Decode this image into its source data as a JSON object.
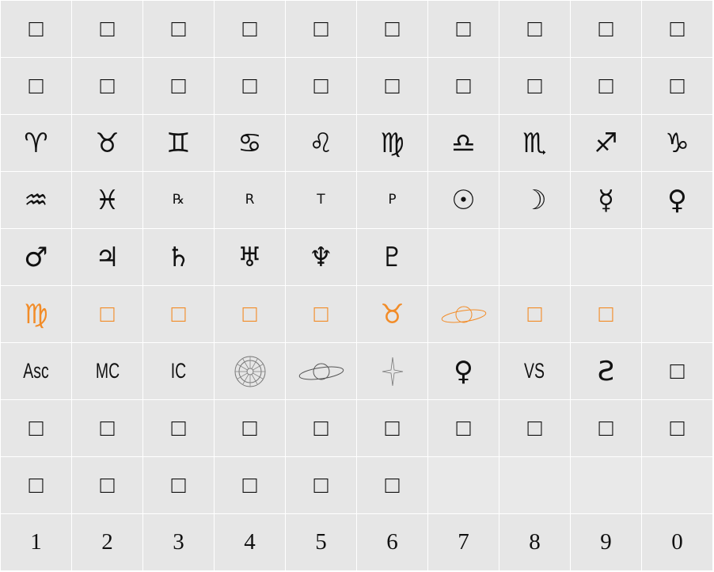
{
  "colors": {
    "background": "#e6e6e6",
    "ink": "#111111",
    "accent": "#f28c28",
    "divider": "#ffffff"
  },
  "rows": [
    [
      {
        "glyph": "□",
        "kind": "notdef"
      },
      {
        "glyph": "□",
        "kind": "notdef"
      },
      {
        "glyph": "□",
        "kind": "notdef"
      },
      {
        "glyph": "□",
        "kind": "notdef"
      },
      {
        "glyph": "□",
        "kind": "notdef"
      },
      {
        "glyph": "□",
        "kind": "notdef"
      },
      {
        "glyph": "□",
        "kind": "notdef"
      },
      {
        "glyph": "□",
        "kind": "notdef"
      },
      {
        "glyph": "□",
        "kind": "notdef"
      },
      {
        "glyph": "□",
        "kind": "notdef"
      }
    ],
    [
      {
        "glyph": "□",
        "kind": "notdef"
      },
      {
        "glyph": "□",
        "kind": "notdef"
      },
      {
        "glyph": "□",
        "kind": "notdef"
      },
      {
        "glyph": "□",
        "kind": "notdef"
      },
      {
        "glyph": "□",
        "kind": "notdef"
      },
      {
        "glyph": "□",
        "kind": "notdef"
      },
      {
        "glyph": "□",
        "kind": "notdef"
      },
      {
        "glyph": "□",
        "kind": "notdef"
      },
      {
        "glyph": "□",
        "kind": "notdef"
      },
      {
        "glyph": "□",
        "kind": "notdef"
      }
    ],
    [
      {
        "glyph": "♈",
        "kind": "sym",
        "name": "aries"
      },
      {
        "glyph": "♉",
        "kind": "sym",
        "name": "taurus"
      },
      {
        "glyph": "♊",
        "kind": "sym",
        "name": "gemini"
      },
      {
        "glyph": "♋",
        "kind": "sym",
        "name": "cancer"
      },
      {
        "glyph": "♌",
        "kind": "sym",
        "name": "leo"
      },
      {
        "glyph": "♍",
        "kind": "sym",
        "name": "virgo"
      },
      {
        "glyph": "♎",
        "kind": "sym",
        "name": "libra"
      },
      {
        "glyph": "♏",
        "kind": "sym",
        "name": "scorpio"
      },
      {
        "glyph": "♐",
        "kind": "sym",
        "name": "sagittarius"
      },
      {
        "glyph": "♑",
        "kind": "sym",
        "name": "capricorn"
      }
    ],
    [
      {
        "glyph": "♒",
        "kind": "sym",
        "name": "aquarius"
      },
      {
        "glyph": "♓",
        "kind": "sym",
        "name": "pisces"
      },
      {
        "glyph": "℞",
        "kind": "small",
        "name": "retrograde"
      },
      {
        "glyph": "R",
        "kind": "small",
        "name": "r-letter"
      },
      {
        "glyph": "T",
        "kind": "small",
        "name": "t-letter"
      },
      {
        "glyph": "P",
        "kind": "small",
        "name": "p-letter"
      },
      {
        "glyph": "☉",
        "kind": "sym",
        "name": "sun"
      },
      {
        "glyph": "☽",
        "kind": "sym",
        "name": "moon"
      },
      {
        "glyph": "☿",
        "kind": "sym",
        "name": "mercury"
      },
      {
        "glyph": "♀",
        "kind": "sym",
        "name": "venus"
      }
    ],
    [
      {
        "glyph": "♂",
        "kind": "sym",
        "name": "mars"
      },
      {
        "glyph": "♃",
        "kind": "sym",
        "name": "jupiter"
      },
      {
        "glyph": "♄",
        "kind": "sym",
        "name": "saturn"
      },
      {
        "glyph": "♅",
        "kind": "sym",
        "name": "uranus"
      },
      {
        "glyph": "♆",
        "kind": "sym",
        "name": "neptune"
      },
      {
        "glyph": "♇",
        "kind": "sym",
        "name": "pluto"
      },
      {
        "kind": "empty"
      },
      {
        "kind": "empty"
      },
      {
        "kind": "empty"
      },
      {
        "kind": "empty"
      }
    ],
    [
      {
        "glyph": "♍",
        "kind": "sym",
        "color": "orange",
        "name": "virgo"
      },
      {
        "glyph": "□",
        "kind": "notdef",
        "color": "orange"
      },
      {
        "glyph": "□",
        "kind": "notdef",
        "color": "orange"
      },
      {
        "glyph": "□",
        "kind": "notdef",
        "color": "orange"
      },
      {
        "glyph": "□",
        "kind": "notdef",
        "color": "orange"
      },
      {
        "glyph": "♉",
        "kind": "sym",
        "color": "orange",
        "name": "taurus"
      },
      {
        "kind": "planet-ring",
        "color": "orange",
        "name": "saturn-planet"
      },
      {
        "glyph": "□",
        "kind": "notdef",
        "color": "orange"
      },
      {
        "glyph": "□",
        "kind": "notdef",
        "color": "orange"
      },
      {
        "kind": "empty"
      }
    ],
    [
      {
        "glyph": "Asc",
        "kind": "txt",
        "name": "ascendant"
      },
      {
        "glyph": "MC",
        "kind": "txt",
        "name": "midheaven"
      },
      {
        "glyph": "IC",
        "kind": "txt",
        "name": "imum-coeli"
      },
      {
        "kind": "wheel",
        "name": "zodiac-wheel"
      },
      {
        "kind": "planet-ring",
        "name": "saturn-planet"
      },
      {
        "kind": "star",
        "name": "star"
      },
      {
        "glyph": "♀",
        "kind": "sym",
        "name": "venus"
      },
      {
        "glyph": "VS",
        "kind": "txt",
        "name": "vs-mark"
      },
      {
        "glyph": "Ƨ",
        "kind": "sym",
        "name": "curl-symbol"
      },
      {
        "glyph": "□",
        "kind": "notdef"
      }
    ],
    [
      {
        "glyph": "□",
        "kind": "notdef"
      },
      {
        "glyph": "□",
        "kind": "notdef"
      },
      {
        "glyph": "□",
        "kind": "notdef"
      },
      {
        "glyph": "□",
        "kind": "notdef"
      },
      {
        "glyph": "□",
        "kind": "notdef"
      },
      {
        "glyph": "□",
        "kind": "notdef"
      },
      {
        "glyph": "□",
        "kind": "notdef"
      },
      {
        "glyph": "□",
        "kind": "notdef"
      },
      {
        "glyph": "□",
        "kind": "notdef"
      },
      {
        "glyph": "□",
        "kind": "notdef"
      }
    ],
    [
      {
        "glyph": "□",
        "kind": "notdef"
      },
      {
        "glyph": "□",
        "kind": "notdef"
      },
      {
        "glyph": "□",
        "kind": "notdef"
      },
      {
        "glyph": "□",
        "kind": "notdef"
      },
      {
        "glyph": "□",
        "kind": "notdef"
      },
      {
        "glyph": "□",
        "kind": "notdef"
      },
      {
        "kind": "empty"
      },
      {
        "kind": "empty"
      },
      {
        "kind": "empty"
      },
      {
        "kind": "empty"
      }
    ],
    [
      {
        "glyph": "1",
        "kind": "digit"
      },
      {
        "glyph": "2",
        "kind": "digit"
      },
      {
        "glyph": "3",
        "kind": "digit"
      },
      {
        "glyph": "4",
        "kind": "digit"
      },
      {
        "glyph": "5",
        "kind": "digit"
      },
      {
        "glyph": "6",
        "kind": "digit"
      },
      {
        "glyph": "7",
        "kind": "digit"
      },
      {
        "glyph": "8",
        "kind": "digit"
      },
      {
        "glyph": "9",
        "kind": "digit"
      },
      {
        "glyph": "0",
        "kind": "digit"
      }
    ]
  ]
}
